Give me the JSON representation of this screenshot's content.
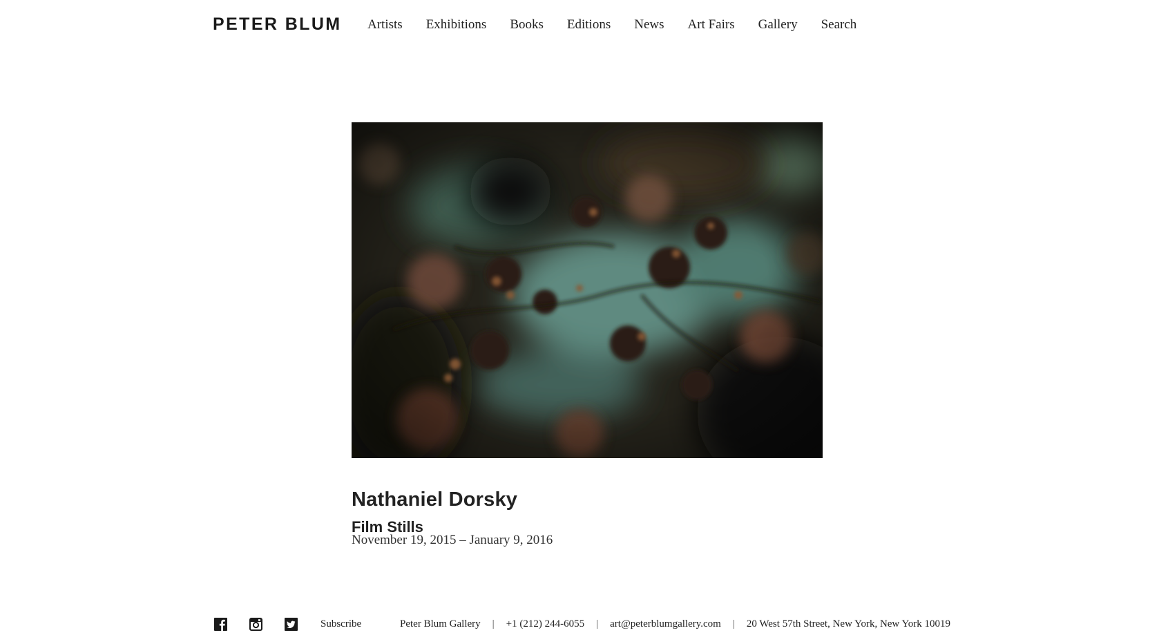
{
  "header": {
    "logo": "PETER BLUM",
    "nav": [
      {
        "label": "Artists"
      },
      {
        "label": "Exhibitions"
      },
      {
        "label": "Books"
      },
      {
        "label": "Editions"
      },
      {
        "label": "News"
      },
      {
        "label": "Art Fairs"
      },
      {
        "label": "Gallery"
      },
      {
        "label": "Search"
      }
    ]
  },
  "exhibition": {
    "artist": "Nathaniel Dorsky",
    "title": "Film Stills",
    "dates": "November 19, 2015 – January 9, 2016"
  },
  "footer": {
    "social": [
      {
        "icon": "facebook-icon"
      },
      {
        "icon": "instagram-icon"
      },
      {
        "icon": "twitter-icon"
      }
    ],
    "subscribe": "Subscribe",
    "gallery_name": "Peter Blum Gallery",
    "separator": "|",
    "phone": "+1 (212) 244-6055",
    "email": "art@peterblumgallery.com",
    "address": "20 West 57th Street, New York, New York 10019"
  },
  "colors": {
    "text": "#222222",
    "background": "#ffffff",
    "image_dark": "#1b1a12",
    "image_teal": "#6f9a8f",
    "image_rust": "#8a4a2c"
  }
}
